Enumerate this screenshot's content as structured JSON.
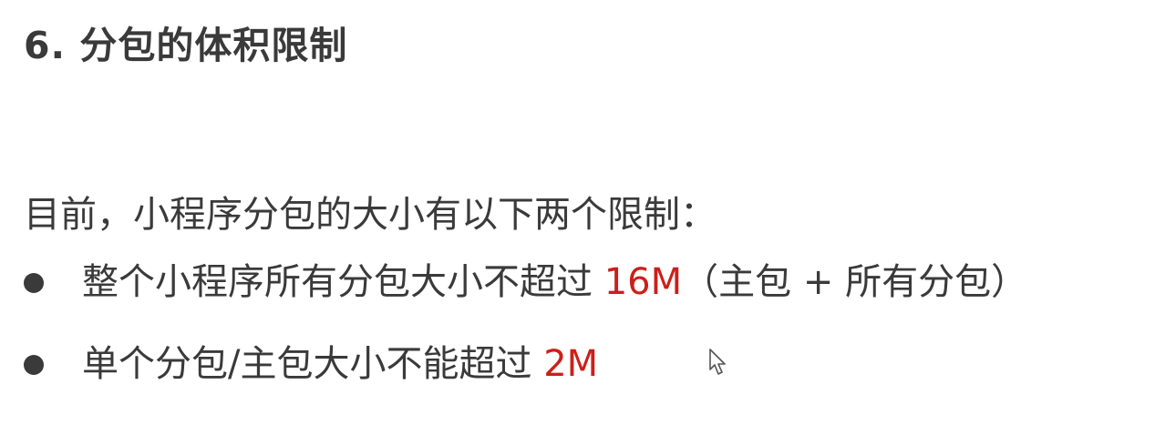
{
  "document": {
    "title": "6. 分包的体积限制",
    "intro": "目前，小程序分包的大小有以下两个限制：",
    "bullets": [
      {
        "text_before": "整个小程序所有分包大小不超过 ",
        "highlight": "16M",
        "text_after": "（主包 + 所有分包）"
      },
      {
        "text_before": "单个分包/主包大小不能超过 ",
        "highlight": "2M",
        "text_after": ""
      }
    ]
  },
  "colors": {
    "text": "#3a3a3a",
    "highlight": "#cc1f1a",
    "background": "#ffffff"
  },
  "icons": {
    "pointer": "mouse-pointer-icon",
    "bullet": "bullet-dot-icon"
  }
}
